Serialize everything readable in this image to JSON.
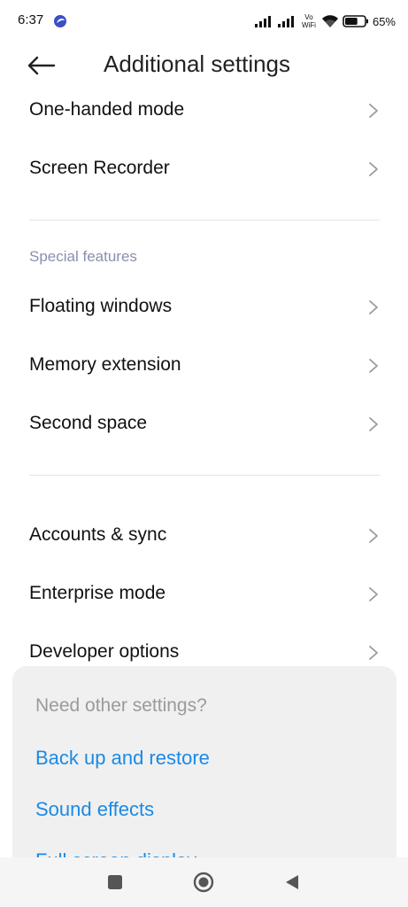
{
  "status_bar": {
    "time": "6:37",
    "vo_label": "Vo",
    "wifi_label": "WiFi",
    "battery_percent": "65%",
    "battery_level": 0.65
  },
  "header": {
    "title": "Additional settings",
    "back_icon": "arrow-left-icon"
  },
  "group1": [
    {
      "label": "One-handed mode"
    },
    {
      "label": "Screen Recorder"
    }
  ],
  "special_features": {
    "header": "Special features",
    "items": [
      {
        "label": "Floating windows"
      },
      {
        "label": "Memory extension"
      },
      {
        "label": "Second space"
      }
    ]
  },
  "group3": [
    {
      "label": "Accounts & sync"
    },
    {
      "label": "Enterprise mode"
    },
    {
      "label": "Developer options"
    }
  ],
  "suggestions": {
    "title": "Need other settings?",
    "links": [
      {
        "label": "Back up and restore"
      },
      {
        "label": "Sound effects"
      },
      {
        "label": "Full screen display"
      }
    ],
    "link_color": "#1a8ae5"
  },
  "nav_bar": {
    "recents_icon": "square-icon",
    "home_icon": "circle-home-icon",
    "back_icon": "triangle-back-icon"
  },
  "colors": {
    "section_header": "#8a8fb0",
    "card_background": "#f0f0f0"
  }
}
